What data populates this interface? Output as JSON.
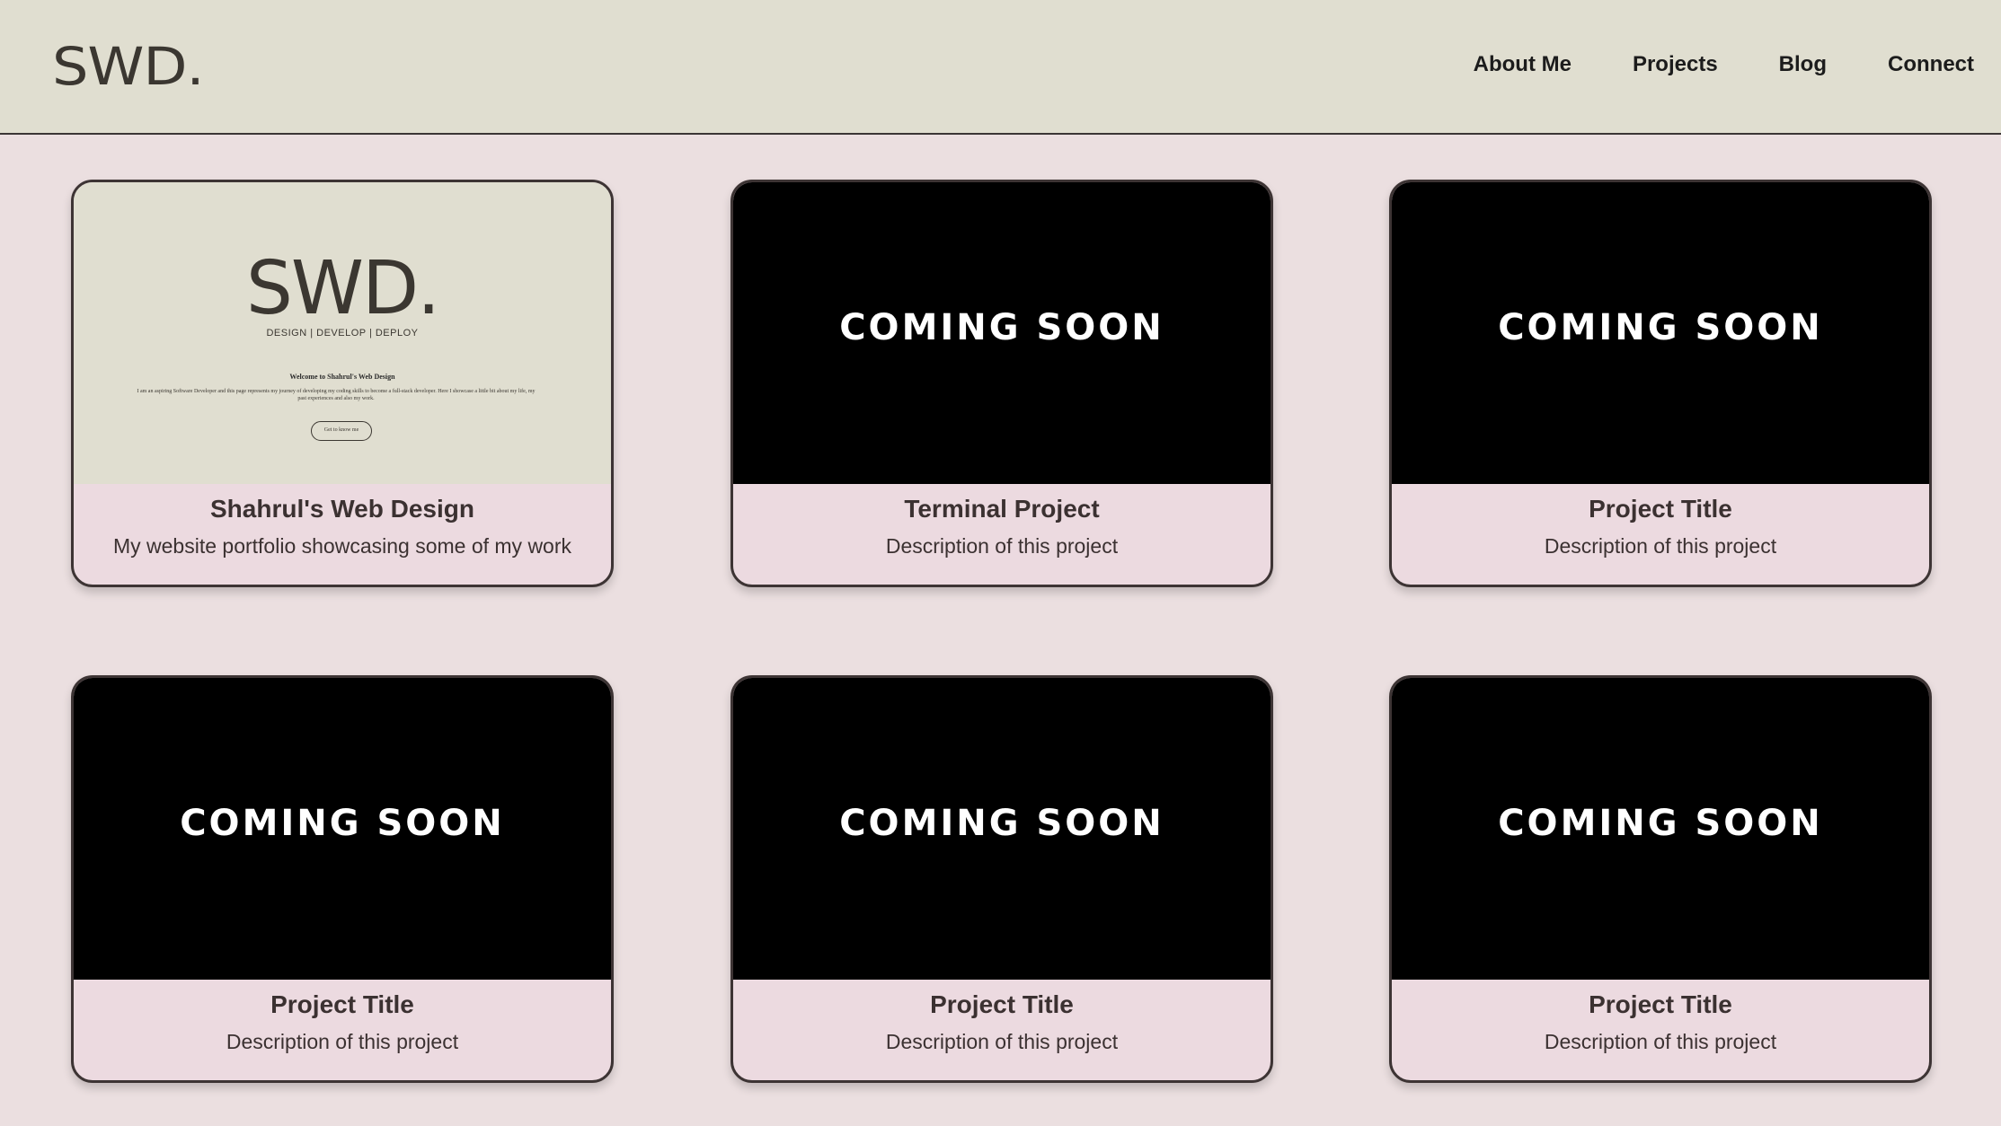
{
  "header": {
    "logo": "SWD.",
    "nav": [
      "About Me",
      "Projects",
      "Blog",
      "Connect"
    ]
  },
  "projects": [
    {
      "title": "Shahrul's Web Design",
      "description": "My website portfolio showcasing some of my work",
      "preview": {
        "logo": "SWD.",
        "tagline": "DESIGN | DEVELOP | DEPLOY",
        "welcome": "Welcome to Shahrul's Web Design",
        "body": "I am an aspiring Software Developer and this page represents my journey of developing my coding skills to become a full-stack developer. Here I showcase a little bit about my life, my past experiences and also my work.",
        "button": "Get to know me"
      }
    },
    {
      "thumb": "COMING SOON",
      "title": "Terminal Project",
      "description": "Description of this project"
    },
    {
      "thumb": "COMING SOON",
      "title": "Project Title",
      "description": "Description of this project"
    },
    {
      "thumb": "COMING SOON",
      "title": "Project Title",
      "description": "Description of this project"
    },
    {
      "thumb": "COMING SOON",
      "title": "Project Title",
      "description": "Description of this project"
    },
    {
      "thumb": "COMING SOON",
      "title": "Project Title",
      "description": "Description of this project"
    }
  ],
  "colors": {
    "header_bg": "#e0ded0",
    "page_bg": "#ebdfe0",
    "card_info_bg": "#ecdae0",
    "card_border": "#3d3434",
    "text_dark": "#3b3131"
  }
}
